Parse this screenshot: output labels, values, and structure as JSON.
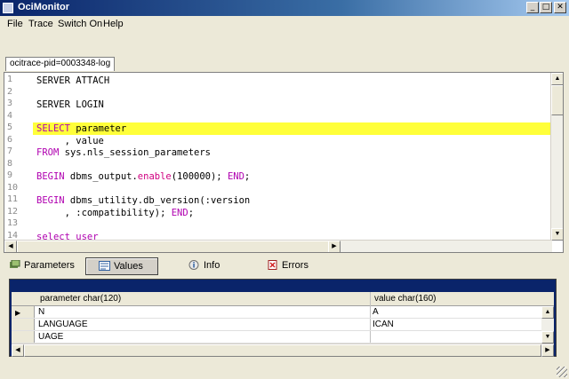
{
  "window": {
    "title": "OciMonitor"
  },
  "menu": [
    "File",
    "Trace",
    "Switch On",
    "Help"
  ],
  "doc_tab": "ocitrace-pid=0003348-log",
  "editor": {
    "lines": [
      {
        "n": "1",
        "tokens": [
          {
            "t": "SERVER ATTACH"
          }
        ]
      },
      {
        "n": "2",
        "tokens": []
      },
      {
        "n": "3",
        "tokens": [
          {
            "t": "SERVER LOGIN"
          }
        ]
      },
      {
        "n": "4",
        "tokens": []
      },
      {
        "n": "5",
        "tokens": [
          {
            "t": "SELECT",
            "c": "kw"
          },
          {
            "t": " parameter"
          }
        ],
        "highlighted": true
      },
      {
        "n": "6",
        "tokens": [
          {
            "t": "     , value"
          }
        ]
      },
      {
        "n": "7",
        "tokens": [
          {
            "t": "FROM",
            "c": "kw"
          },
          {
            "t": " sys.nls_session_parameters"
          }
        ]
      },
      {
        "n": "8",
        "tokens": []
      },
      {
        "n": "9",
        "tokens": [
          {
            "t": "BEGIN",
            "c": "kw"
          },
          {
            "t": " dbms_output."
          },
          {
            "t": "enable",
            "c": "fn"
          },
          {
            "t": "(100000); "
          },
          {
            "t": "END",
            "c": "kw"
          },
          {
            "t": ";"
          }
        ]
      },
      {
        "n": "10",
        "tokens": []
      },
      {
        "n": "11",
        "tokens": [
          {
            "t": "BEGIN",
            "c": "kw"
          },
          {
            "t": " dbms_utility.db_version(:version"
          }
        ]
      },
      {
        "n": "12",
        "tokens": [
          {
            "t": "     , :compatibility); "
          },
          {
            "t": "END",
            "c": "kw"
          },
          {
            "t": ";"
          }
        ]
      },
      {
        "n": "13",
        "tokens": []
      },
      {
        "n": "14",
        "tokens": [
          {
            "t": "select user",
            "c": "kw"
          }
        ]
      }
    ],
    "highlight_color": "#ffff3a"
  },
  "panel_tabs": [
    {
      "label": "Parameters",
      "icon": "parameters-icon",
      "active": false
    },
    {
      "label": "Values",
      "icon": "values-icon",
      "active": true
    },
    {
      "label": "Info",
      "icon": "info-icon",
      "active": false
    },
    {
      "label": "Errors",
      "icon": "errors-icon",
      "active": false
    }
  ],
  "grid": {
    "columns": [
      "parameter char(120)",
      "value char(160)"
    ],
    "rows": [
      [
        "N",
        "A"
      ],
      [
        "LANGUAGE",
        "ICAN"
      ],
      [
        "UAGE",
        ""
      ]
    ]
  },
  "colors": {
    "titlebar": "#0a246a",
    "keyword": "#b000b0",
    "function": "#d00080"
  }
}
